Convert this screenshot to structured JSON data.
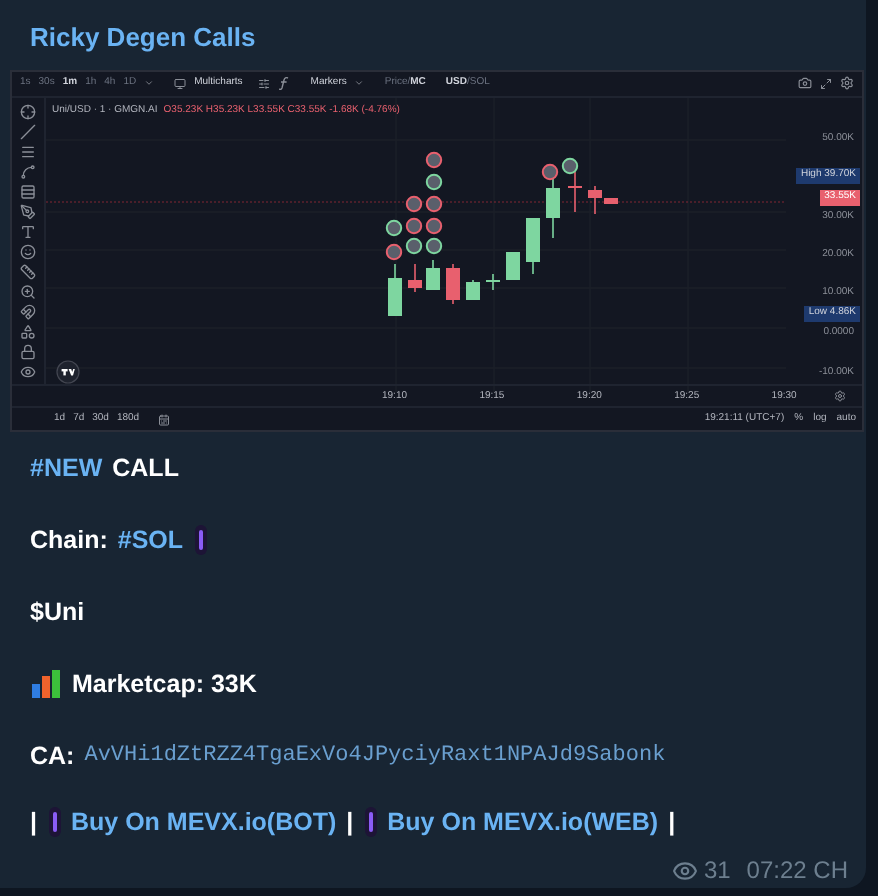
{
  "channel": {
    "title": "Ricky Degen Calls"
  },
  "chart_screenshot": {
    "intervals": [
      {
        "label": "1s",
        "selected": false
      },
      {
        "label": "30s",
        "selected": false
      },
      {
        "label": "1m",
        "selected": true
      },
      {
        "label": "1h",
        "selected": false
      },
      {
        "label": "4h",
        "selected": false
      },
      {
        "label": "1D",
        "selected": false
      }
    ],
    "multicharts": "Multicharts",
    "markers": "Markers",
    "price_mode": [
      {
        "label": "Price/",
        "selected": false
      },
      {
        "label": "MC",
        "selected": true
      }
    ],
    "currency": [
      {
        "label": "USD",
        "selected": true
      },
      {
        "label": "/SOL",
        "selected": false
      }
    ],
    "legend": "Uni/USD · 1 · GMGN.AI",
    "ohlc": "O35.23K H35.23K L33.55K C33.55K -1.68K (-4.76%)",
    "price_labels": [
      {
        "kind": "tick",
        "label": "50.00K"
      },
      {
        "kind": "high",
        "label": "High",
        "value": "39.70K"
      },
      {
        "kind": "last",
        "label": "33.55K"
      },
      {
        "kind": "tick",
        "label": "30.00K"
      },
      {
        "kind": "tick",
        "label": "20.00K"
      },
      {
        "kind": "tick",
        "label": "10.00K"
      },
      {
        "kind": "low",
        "label": "Low",
        "value": "4.86K"
      },
      {
        "kind": "tick",
        "label": "0.0000"
      },
      {
        "kind": "tick",
        "label": "-10.00K"
      }
    ],
    "time_labels": [
      "19:10",
      "19:15",
      "19:20",
      "19:25",
      "19:30"
    ],
    "ranges": [
      "1d",
      "7d",
      "30d",
      "180d"
    ],
    "clock": "19:21:11 (UTC+7)",
    "scale_options": [
      "%",
      "log",
      "auto"
    ]
  },
  "message": {
    "lines": [
      [
        {
          "kind": "hashtag",
          "text": "#NEW"
        },
        {
          "kind": "text",
          "text": "CALL"
        }
      ],
      [
        {
          "kind": "text",
          "text": "Chain:"
        },
        {
          "kind": "hashtag",
          "text": "#SOL"
        },
        {
          "kind": "pill"
        }
      ],
      [
        {
          "kind": "text",
          "text": "$Uni"
        }
      ],
      [
        {
          "kind": "chart_emoji"
        },
        {
          "kind": "text",
          "text": "Marketcap: 33K"
        }
      ],
      [
        {
          "kind": "text",
          "text": "CA:"
        },
        {
          "kind": "code",
          "text": "AvVHi1dZtRZZ4TgaExVo4JPyciyRaxt1NPAJd9Sabonk"
        }
      ],
      [
        {
          "kind": "separator",
          "text": "|"
        },
        {
          "kind": "pill"
        },
        {
          "kind": "link",
          "text": "Buy On MEVX.io(BOT)"
        },
        {
          "kind": "separator",
          "text": "|"
        },
        {
          "kind": "pill"
        },
        {
          "kind": "link",
          "text": "Buy On MEVX.io(WEB)"
        },
        {
          "kind": "separator",
          "text": "|"
        }
      ]
    ],
    "views": "31",
    "time": "07:22 CH"
  }
}
